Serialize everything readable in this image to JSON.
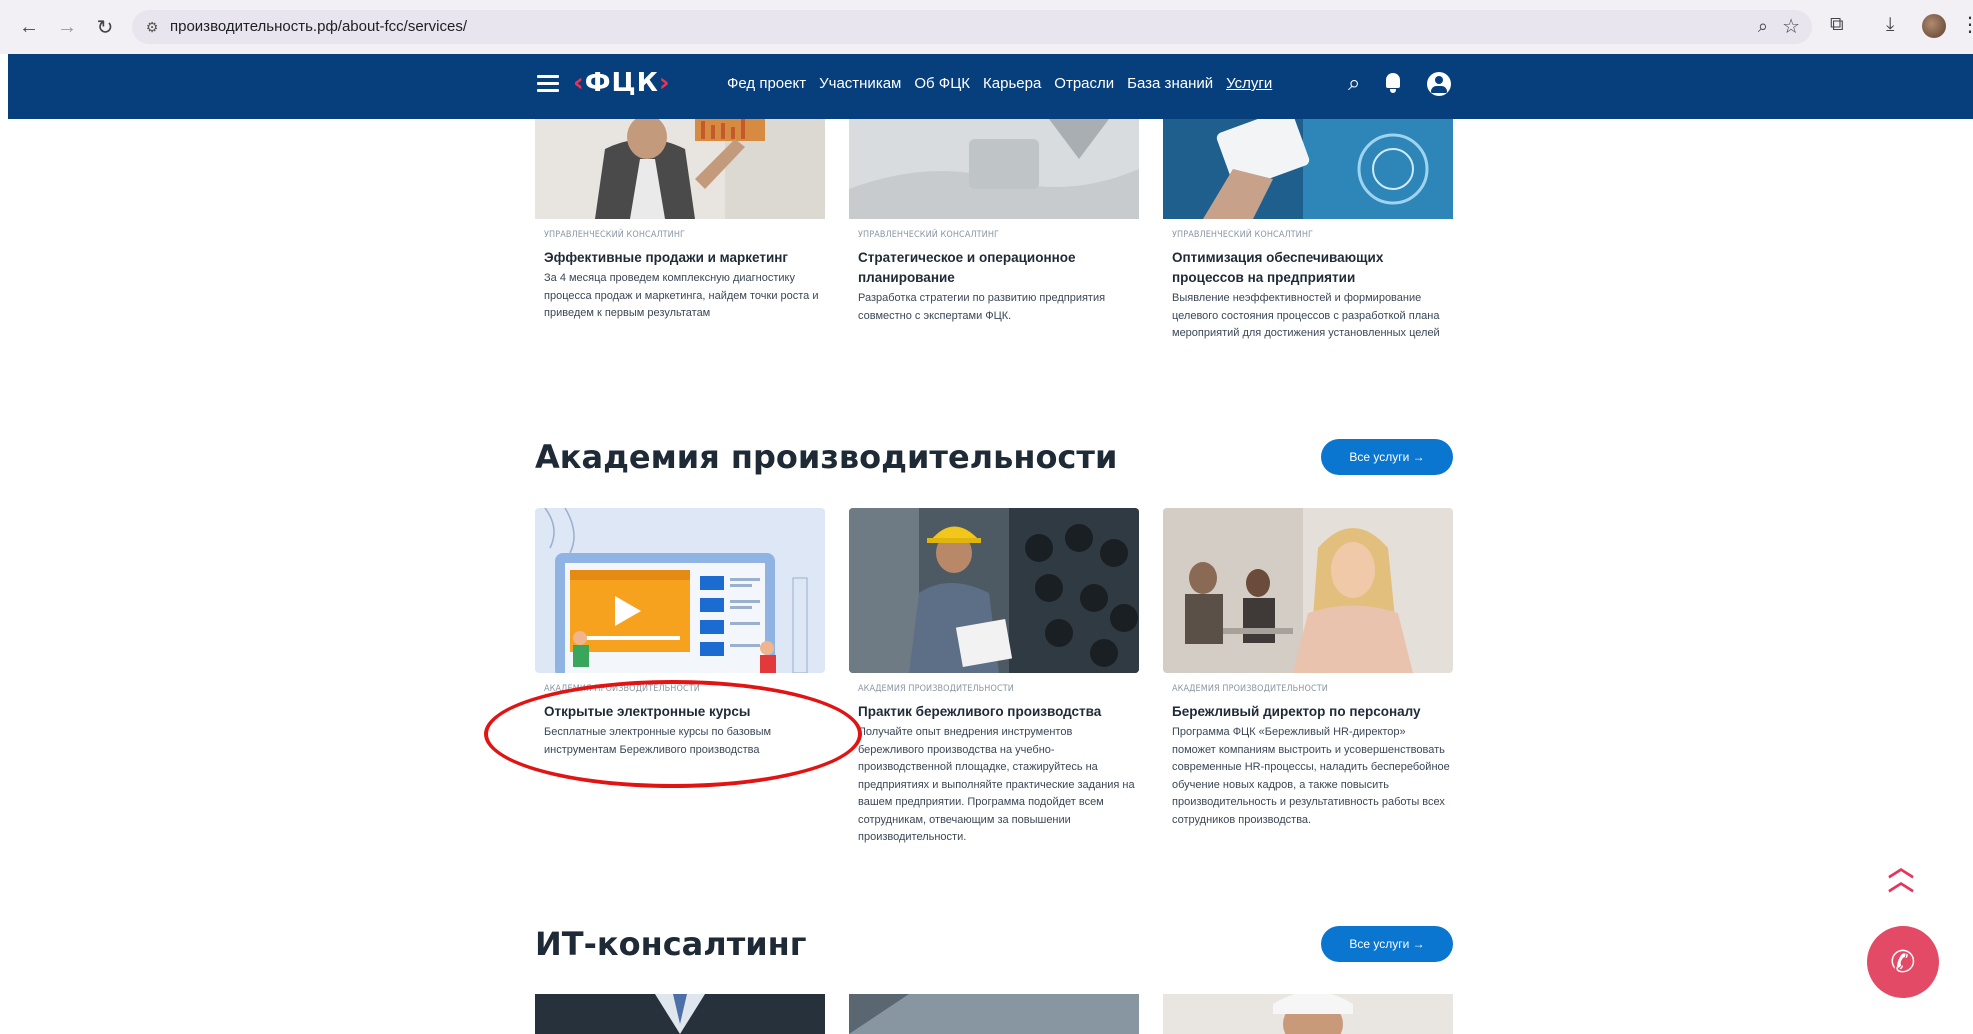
{
  "browser": {
    "url": "производительность.рф/about-fcc/services/"
  },
  "header": {
    "logo": "ФЦК",
    "nav": [
      "Фед проект",
      "Участникам",
      "Об ФЦК",
      "Карьера",
      "Отрасли",
      "База знаний",
      "Услуги"
    ],
    "active_nav": "Услуги"
  },
  "consulting_cards": [
    {
      "tag": "Управленческий консалтинг",
      "title": "Эффективные продажи и маркетинг",
      "desc": "За 4 месяца проведем комплексную диагностику процесса продаж и маркетинга, найдем точки роста и приведем к первым результатам"
    },
    {
      "tag": "Управленческий консалтинг",
      "title": "Стратегическое и операционное планирование",
      "desc": "Разработка стратегии по развитию предприятия совместно с экспертами ФЦК."
    },
    {
      "tag": "Управленческий консалтинг",
      "title": "Оптимизация обеспечивающих процессов на предприятии",
      "desc": "Выявление неэффективностей и формирование целевого состояния процессов с разработкой плана мероприятий для достижения установленных целей"
    }
  ],
  "academy": {
    "title": "Академия производительности",
    "all_button": "Все услуги →",
    "cards": [
      {
        "tag": "Академия производительности",
        "title": "Открытые электронные курсы",
        "desc": "Бесплатные электронные курсы по базовым инструментам Бережливого производства"
      },
      {
        "tag": "Академия производительности",
        "title": "Практик бережливого производства",
        "desc": "Получайте опыт внедрения инструментов бережливого производства на учебно-производственной площадке, стажируйтесь на предприятиях и выполняйте практические задания на вашем предприятии. Программа подойдет всем сотрудникам, отвечающим за повышении производительности."
      },
      {
        "tag": "Академия производительности",
        "title": "Бережливый директор по персоналу",
        "desc": "Программа ФЦК «Бережливый HR-директор» поможет компаниям выстроить и усовершенствовать современные HR-процессы, наладить бесперебойное обучение новых кадров, а также повысить производительность и результативность работы всех сотрудников производства."
      }
    ]
  },
  "it": {
    "title": "ИТ-консалтинг",
    "all_button": "Все услуги →"
  },
  "colors": {
    "header_bg": "#073f7c",
    "button_blue": "#0a76cf",
    "accent_red": "#e34a66",
    "highlight": "#e21313"
  }
}
